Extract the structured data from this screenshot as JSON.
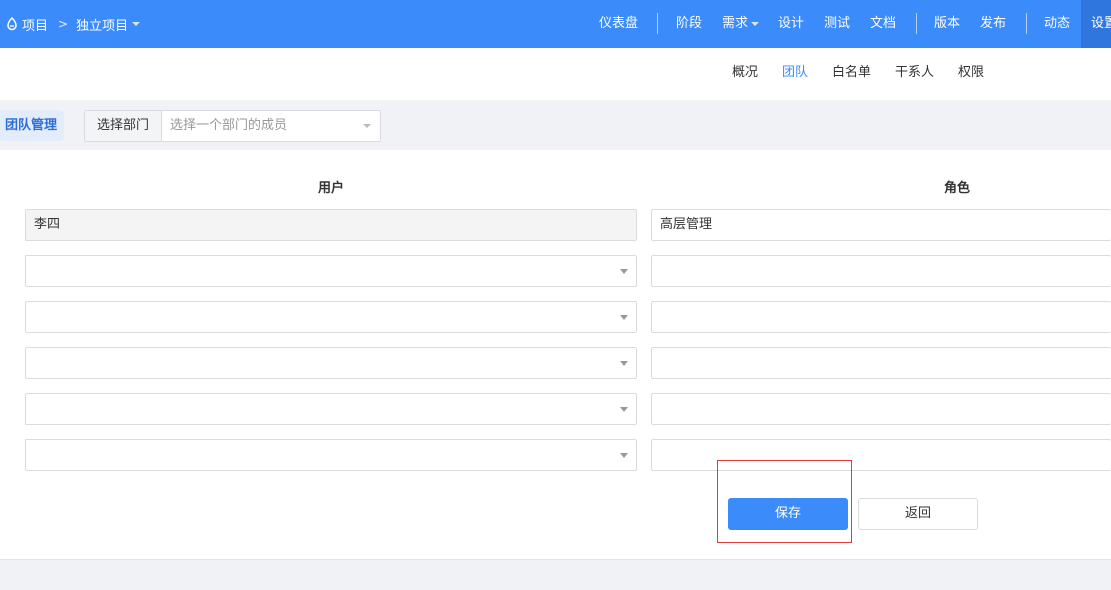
{
  "topbar": {
    "breadcrumb": {
      "root": "项目",
      "current": "独立项目"
    },
    "nav": {
      "dashboard": "仪表盘",
      "stage": "阶段",
      "requirement": "需求",
      "design": "设计",
      "test": "测试",
      "document": "文档",
      "version": "版本",
      "release": "发布",
      "activity": "动态",
      "settings": "设置"
    }
  },
  "subnav": {
    "overview": "概况",
    "team": "团队",
    "whitelist": "白名单",
    "stakeholders": "干系人",
    "permissions": "权限"
  },
  "toolbar": {
    "team_manage": "团队管理",
    "dept_label": "选择部门",
    "dept_placeholder": "选择一个部门的成员"
  },
  "table": {
    "user_header": "用户",
    "role_header": "角色",
    "rows": [
      {
        "user": "李四",
        "role": "高层管理"
      },
      {
        "user": "",
        "role": ""
      },
      {
        "user": "",
        "role": ""
      },
      {
        "user": "",
        "role": ""
      },
      {
        "user": "",
        "role": ""
      },
      {
        "user": "",
        "role": ""
      }
    ]
  },
  "actions": {
    "save": "保存",
    "back": "返回"
  },
  "colors": {
    "primary": "#3b8bfb",
    "highlight": "#e23a3a"
  }
}
